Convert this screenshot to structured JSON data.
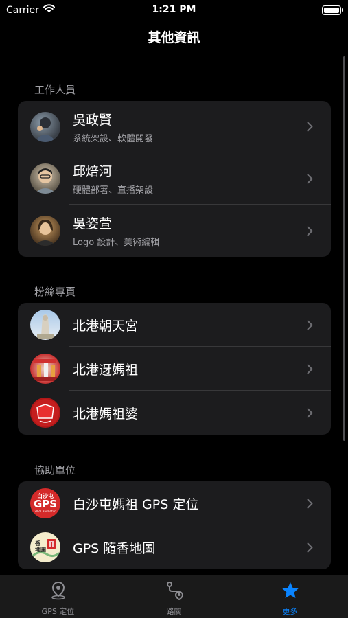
{
  "status": {
    "carrier": "Carrier",
    "time": "1:21 PM"
  },
  "nav": {
    "title": "其他資訊"
  },
  "sections": [
    {
      "header": "工作人員",
      "rows": [
        {
          "name": "吳政賢",
          "subtitle": "系統架設、軟體開發",
          "icon": "avatar-photo"
        },
        {
          "name": "邱焙河",
          "subtitle": "硬體部署、直播架設",
          "icon": "avatar-photo"
        },
        {
          "name": "吳姿萱",
          "subtitle": "Logo 設計、美術編輯",
          "icon": "avatar-photo"
        }
      ]
    },
    {
      "header": "粉絲專頁",
      "rows": [
        {
          "name": "北港朝天宮",
          "icon": "temple-statue-photo"
        },
        {
          "name": "北港迓媽祖",
          "icon": "procession-photo"
        },
        {
          "name": "北港媽祖婆",
          "icon": "red-logo"
        }
      ]
    },
    {
      "header": "協助單位",
      "rows": [
        {
          "name": "白沙屯媽祖 GPS 定位",
          "icon": "gps-logo",
          "logo_text": "白沙屯",
          "logo_big": "GPS",
          "logo_small": "2022 Baishatun"
        },
        {
          "name": "GPS 隨香地圖",
          "icon": "map-logo",
          "logo_text": "香\n地圖"
        }
      ]
    }
  ],
  "tabs": [
    {
      "label": "GPS 定位",
      "icon": "location-pin-icon",
      "active": false
    },
    {
      "label": "路關",
      "icon": "route-icon",
      "active": false
    },
    {
      "label": "更多",
      "icon": "star-icon",
      "active": true
    }
  ],
  "colors": {
    "accent": "#0a84ff",
    "background": "#000000",
    "cell": "#1c1c1e"
  }
}
